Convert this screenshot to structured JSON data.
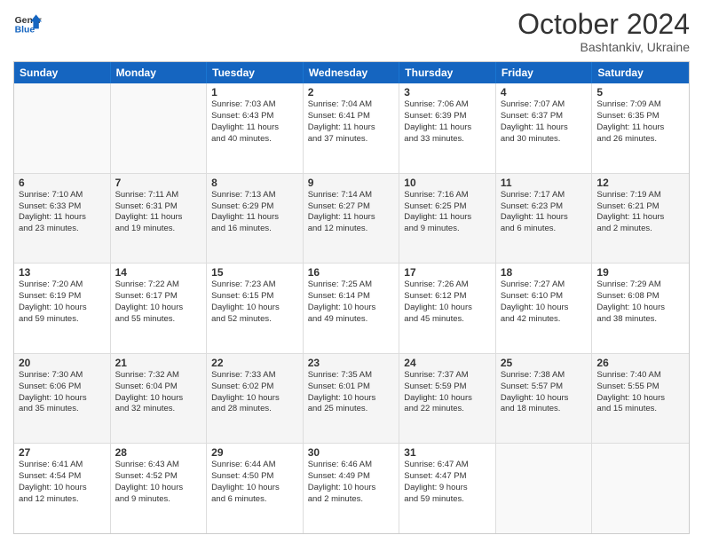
{
  "header": {
    "logo_line1": "General",
    "logo_line2": "Blue",
    "main_title": "October 2024",
    "subtitle": "Bashtankiv, Ukraine"
  },
  "calendar": {
    "days": [
      "Sunday",
      "Monday",
      "Tuesday",
      "Wednesday",
      "Thursday",
      "Friday",
      "Saturday"
    ],
    "rows": [
      [
        {
          "day": "",
          "lines": []
        },
        {
          "day": "",
          "lines": []
        },
        {
          "day": "1",
          "lines": [
            "Sunrise: 7:03 AM",
            "Sunset: 6:43 PM",
            "Daylight: 11 hours",
            "and 40 minutes."
          ]
        },
        {
          "day": "2",
          "lines": [
            "Sunrise: 7:04 AM",
            "Sunset: 6:41 PM",
            "Daylight: 11 hours",
            "and 37 minutes."
          ]
        },
        {
          "day": "3",
          "lines": [
            "Sunrise: 7:06 AM",
            "Sunset: 6:39 PM",
            "Daylight: 11 hours",
            "and 33 minutes."
          ]
        },
        {
          "day": "4",
          "lines": [
            "Sunrise: 7:07 AM",
            "Sunset: 6:37 PM",
            "Daylight: 11 hours",
            "and 30 minutes."
          ]
        },
        {
          "day": "5",
          "lines": [
            "Sunrise: 7:09 AM",
            "Sunset: 6:35 PM",
            "Daylight: 11 hours",
            "and 26 minutes."
          ]
        }
      ],
      [
        {
          "day": "6",
          "lines": [
            "Sunrise: 7:10 AM",
            "Sunset: 6:33 PM",
            "Daylight: 11 hours",
            "and 23 minutes."
          ]
        },
        {
          "day": "7",
          "lines": [
            "Sunrise: 7:11 AM",
            "Sunset: 6:31 PM",
            "Daylight: 11 hours",
            "and 19 minutes."
          ]
        },
        {
          "day": "8",
          "lines": [
            "Sunrise: 7:13 AM",
            "Sunset: 6:29 PM",
            "Daylight: 11 hours",
            "and 16 minutes."
          ]
        },
        {
          "day": "9",
          "lines": [
            "Sunrise: 7:14 AM",
            "Sunset: 6:27 PM",
            "Daylight: 11 hours",
            "and 12 minutes."
          ]
        },
        {
          "day": "10",
          "lines": [
            "Sunrise: 7:16 AM",
            "Sunset: 6:25 PM",
            "Daylight: 11 hours",
            "and 9 minutes."
          ]
        },
        {
          "day": "11",
          "lines": [
            "Sunrise: 7:17 AM",
            "Sunset: 6:23 PM",
            "Daylight: 11 hours",
            "and 6 minutes."
          ]
        },
        {
          "day": "12",
          "lines": [
            "Sunrise: 7:19 AM",
            "Sunset: 6:21 PM",
            "Daylight: 11 hours",
            "and 2 minutes."
          ]
        }
      ],
      [
        {
          "day": "13",
          "lines": [
            "Sunrise: 7:20 AM",
            "Sunset: 6:19 PM",
            "Daylight: 10 hours",
            "and 59 minutes."
          ]
        },
        {
          "day": "14",
          "lines": [
            "Sunrise: 7:22 AM",
            "Sunset: 6:17 PM",
            "Daylight: 10 hours",
            "and 55 minutes."
          ]
        },
        {
          "day": "15",
          "lines": [
            "Sunrise: 7:23 AM",
            "Sunset: 6:15 PM",
            "Daylight: 10 hours",
            "and 52 minutes."
          ]
        },
        {
          "day": "16",
          "lines": [
            "Sunrise: 7:25 AM",
            "Sunset: 6:14 PM",
            "Daylight: 10 hours",
            "and 49 minutes."
          ]
        },
        {
          "day": "17",
          "lines": [
            "Sunrise: 7:26 AM",
            "Sunset: 6:12 PM",
            "Daylight: 10 hours",
            "and 45 minutes."
          ]
        },
        {
          "day": "18",
          "lines": [
            "Sunrise: 7:27 AM",
            "Sunset: 6:10 PM",
            "Daylight: 10 hours",
            "and 42 minutes."
          ]
        },
        {
          "day": "19",
          "lines": [
            "Sunrise: 7:29 AM",
            "Sunset: 6:08 PM",
            "Daylight: 10 hours",
            "and 38 minutes."
          ]
        }
      ],
      [
        {
          "day": "20",
          "lines": [
            "Sunrise: 7:30 AM",
            "Sunset: 6:06 PM",
            "Daylight: 10 hours",
            "and 35 minutes."
          ]
        },
        {
          "day": "21",
          "lines": [
            "Sunrise: 7:32 AM",
            "Sunset: 6:04 PM",
            "Daylight: 10 hours",
            "and 32 minutes."
          ]
        },
        {
          "day": "22",
          "lines": [
            "Sunrise: 7:33 AM",
            "Sunset: 6:02 PM",
            "Daylight: 10 hours",
            "and 28 minutes."
          ]
        },
        {
          "day": "23",
          "lines": [
            "Sunrise: 7:35 AM",
            "Sunset: 6:01 PM",
            "Daylight: 10 hours",
            "and 25 minutes."
          ]
        },
        {
          "day": "24",
          "lines": [
            "Sunrise: 7:37 AM",
            "Sunset: 5:59 PM",
            "Daylight: 10 hours",
            "and 22 minutes."
          ]
        },
        {
          "day": "25",
          "lines": [
            "Sunrise: 7:38 AM",
            "Sunset: 5:57 PM",
            "Daylight: 10 hours",
            "and 18 minutes."
          ]
        },
        {
          "day": "26",
          "lines": [
            "Sunrise: 7:40 AM",
            "Sunset: 5:55 PM",
            "Daylight: 10 hours",
            "and 15 minutes."
          ]
        }
      ],
      [
        {
          "day": "27",
          "lines": [
            "Sunrise: 6:41 AM",
            "Sunset: 4:54 PM",
            "Daylight: 10 hours",
            "and 12 minutes."
          ]
        },
        {
          "day": "28",
          "lines": [
            "Sunrise: 6:43 AM",
            "Sunset: 4:52 PM",
            "Daylight: 10 hours",
            "and 9 minutes."
          ]
        },
        {
          "day": "29",
          "lines": [
            "Sunrise: 6:44 AM",
            "Sunset: 4:50 PM",
            "Daylight: 10 hours",
            "and 6 minutes."
          ]
        },
        {
          "day": "30",
          "lines": [
            "Sunrise: 6:46 AM",
            "Sunset: 4:49 PM",
            "Daylight: 10 hours",
            "and 2 minutes."
          ]
        },
        {
          "day": "31",
          "lines": [
            "Sunrise: 6:47 AM",
            "Sunset: 4:47 PM",
            "Daylight: 9 hours",
            "and 59 minutes."
          ]
        },
        {
          "day": "",
          "lines": []
        },
        {
          "day": "",
          "lines": []
        }
      ]
    ]
  }
}
